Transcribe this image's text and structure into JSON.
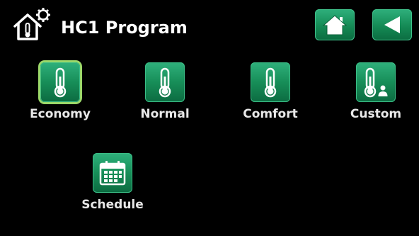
{
  "header": {
    "title": "HC1 Program",
    "icon": "house-thermometer-gear-icon"
  },
  "nav": {
    "home_icon": "home-icon",
    "back_icon": "back-arrow-icon"
  },
  "programs": [
    {
      "label": "Economy",
      "icon": "thermometer-icon",
      "selected": true
    },
    {
      "label": "Normal",
      "icon": "thermometer-icon",
      "selected": false
    },
    {
      "label": "Comfort",
      "icon": "thermometer-icon",
      "selected": false
    },
    {
      "label": "Custom",
      "icon": "thermometer-user-icon",
      "selected": false
    },
    {
      "label": "Schedule",
      "icon": "calendar-icon",
      "selected": false
    }
  ],
  "colors": {
    "background": "#000000",
    "button_green": "#178e58",
    "selected_outline": "#9bd86a",
    "text": "#ffffff"
  }
}
